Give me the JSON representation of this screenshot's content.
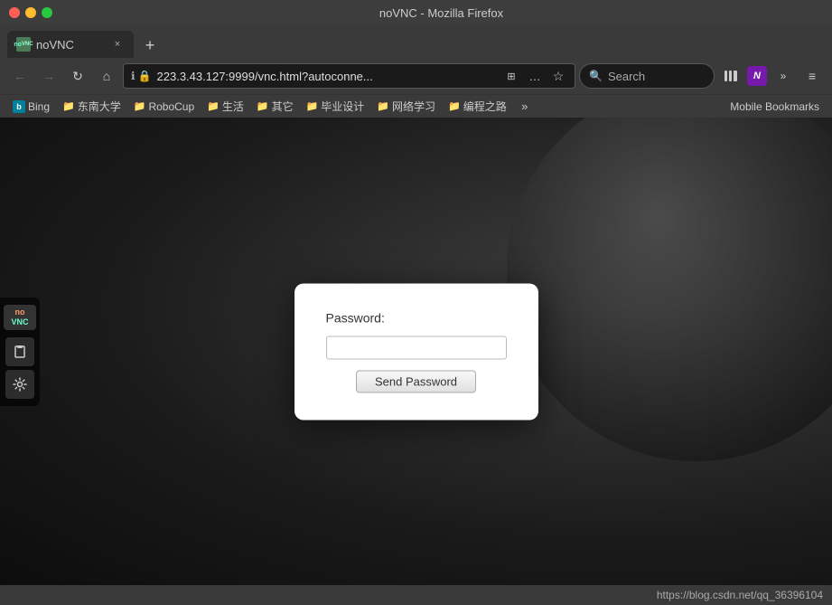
{
  "title_bar": {
    "title": "noVNC - Mozilla Firefox",
    "tl_close": "×",
    "tl_minimize": "−",
    "tl_maximize": "+"
  },
  "tab": {
    "favicon_text": "VNC",
    "label": "noVNC",
    "close": "×"
  },
  "new_tab_btn": "+",
  "toolbar": {
    "back": "←",
    "forward": "→",
    "reload": "↻",
    "home": "⌂",
    "security_icon": "🔒",
    "url": "223.3.43.127:9999/vnc.html?autoconne...",
    "qr_icon": "⊞",
    "more_icon": "…",
    "star_icon": "☆",
    "search_placeholder": "Search",
    "library_icon": "📚",
    "onenote_label": "N",
    "overflow_icon": ">>",
    "menu_icon": "≡"
  },
  "bookmarks": {
    "bing_label": "Bing",
    "items": [
      {
        "icon": "📁",
        "label": "东南大学"
      },
      {
        "icon": "📁",
        "label": "RoboCup"
      },
      {
        "icon": "📁",
        "label": "生活"
      },
      {
        "icon": "📁",
        "label": "其它"
      },
      {
        "icon": "📁",
        "label": "毕业设计"
      },
      {
        "icon": "📁",
        "label": "网络学习"
      },
      {
        "icon": "📁",
        "label": "编程之路"
      }
    ],
    "overflow": "»",
    "mobile_bookmarks": "Mobile Bookmarks"
  },
  "password_dialog": {
    "label": "Password:",
    "input_placeholder": "",
    "button_label": "Send Password"
  },
  "status_bar": {
    "url": "https://blog.csdn.net/qq_36396104"
  },
  "vnc_logo": {
    "no": "no",
    "vnc": "VNC"
  },
  "sidebar": {
    "icon1": "⊡",
    "icon2": "⚙"
  }
}
